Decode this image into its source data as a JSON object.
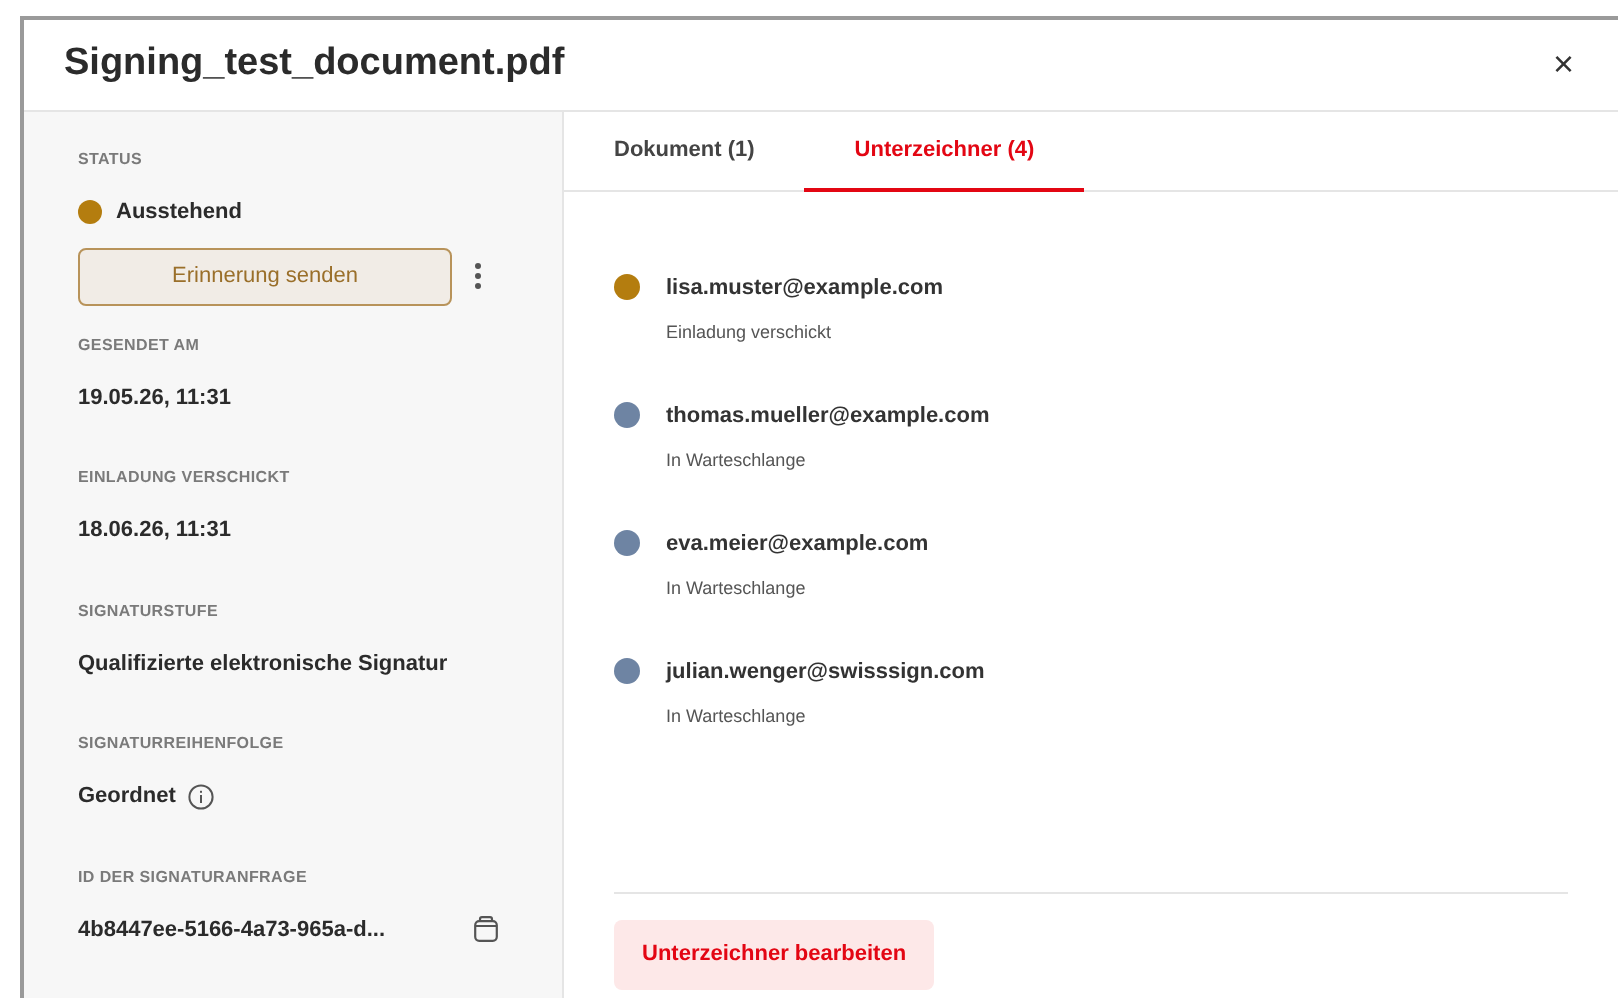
{
  "dialog": {
    "title": "Signing_test_document.pdf",
    "close": "×"
  },
  "details": [
    {
      "label": "STATUS",
      "kind": "status",
      "value": "Ausstehend",
      "color": "#b47d0f",
      "action": "Erinnerung senden"
    },
    {
      "label": "GESENDET AM",
      "kind": "text",
      "value": "19.05.26, 11:31"
    },
    {
      "label": "EINLADUNG VERSCHICKT",
      "kind": "text",
      "value": "18.06.26, 11:31"
    },
    {
      "label": "SIGNATURSTUFE",
      "kind": "text",
      "value": "Qualifizierte elektronische Signatur"
    },
    {
      "label": "SIGNATURREIHENFOLGE",
      "kind": "info",
      "value": "Geordnet"
    },
    {
      "label": "ID DER SIGNATURANFRAGE",
      "kind": "copy",
      "value": "4b8447ee-5166-4a73-965a-d..."
    }
  ],
  "tabs": [
    {
      "label": "Dokument (1)",
      "selected": false
    },
    {
      "label": "Unterzeichner (4)",
      "selected": true
    }
  ],
  "signers": [
    {
      "email": "lisa.muster@example.com",
      "status": "Einladung verschickt",
      "color": "#b47d0f"
    },
    {
      "email": "thomas.mueller@example.com",
      "status": "In Warteschlange",
      "color": "#6e84a3"
    },
    {
      "email": "eva.meier@example.com",
      "status": "In Warteschlange",
      "color": "#6e84a3"
    },
    {
      "email": "julian.wenger@swisssign.com",
      "status": "In Warteschlange",
      "color": "#6e84a3"
    }
  ],
  "edit_button": "Unterzeichner bearbeiten"
}
